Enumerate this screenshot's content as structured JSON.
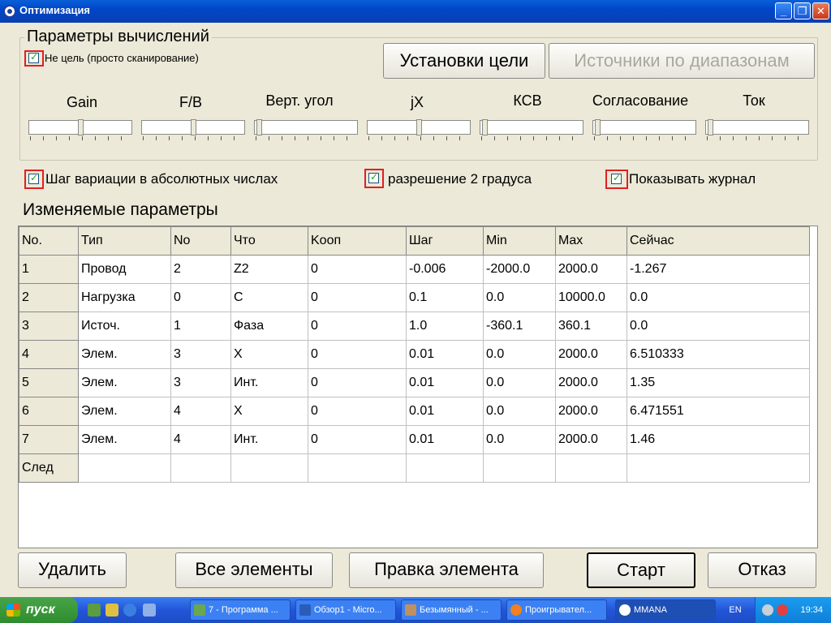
{
  "window": {
    "title": "Оптимизация",
    "controls": {
      "minimize": "_",
      "maximize": "❐",
      "close": "✕"
    }
  },
  "params_group": {
    "title": "Параметры вычислений",
    "no_target_label": "Не цель (просто сканирование)",
    "target_settings_button": "Установки цели",
    "range_sources_button": "Источники по диапазонам",
    "sliders": [
      "Gain",
      "F/B",
      "Верт. угол",
      "jX",
      "КСВ",
      "Согласование",
      "Ток"
    ]
  },
  "options": {
    "abs_step_label": "Шаг вариации в абсолютных числах",
    "resolution_label": "разрешение 2 градуса",
    "show_log_label": "Показывать журнал"
  },
  "variables": {
    "title": "Изменяемые параметры",
    "columns": [
      "No.",
      "Тип",
      "No",
      "Что",
      "Kооп",
      "Шаг",
      "Min",
      "Max",
      "Сейчас"
    ],
    "rows": [
      [
        "1",
        "Провод",
        "2",
        " Z2",
        "0",
        "-0.006",
        "-2000.0",
        "2000.0",
        "-1.267"
      ],
      [
        "2",
        "Нагрузка",
        "0",
        "C",
        "0",
        "0.1",
        "0.0",
        "10000.0",
        "0.0"
      ],
      [
        "3",
        "Источ.",
        "1",
        "Фаза",
        "0",
        "1.0",
        "-360.1",
        "360.1",
        "0.0"
      ],
      [
        "4",
        "Элем.",
        "3",
        " X",
        "0",
        "0.01",
        "0.0",
        "2000.0",
        "6.510333"
      ],
      [
        "5",
        "Элем.",
        "3",
        "Инт.",
        "0",
        "0.01",
        "0.0",
        "2000.0",
        "1.35"
      ],
      [
        "6",
        "Элем.",
        "4",
        " X",
        "0",
        "0.01",
        "0.0",
        "2000.0",
        "6.471551"
      ],
      [
        "7",
        "Элем.",
        "4",
        "Инт.",
        "0",
        "0.01",
        "0.0",
        "2000.0",
        "1.46"
      ],
      [
        "След",
        "",
        "",
        "",
        "",
        "",
        "",
        "",
        ""
      ]
    ]
  },
  "buttons": {
    "delete": "Удалить",
    "all_elements": "Все элементы",
    "edit_element": "Правка элемента",
    "start": "Старт",
    "cancel": "Отказ"
  },
  "taskbar": {
    "start_label": "пуск",
    "tasks": [
      "7 - Программа ...",
      "Обзор1 - Micro...",
      "Безымянный - ...",
      "Проигрывател...",
      "MMANA"
    ],
    "language": "EN",
    "clock": "19:34"
  }
}
